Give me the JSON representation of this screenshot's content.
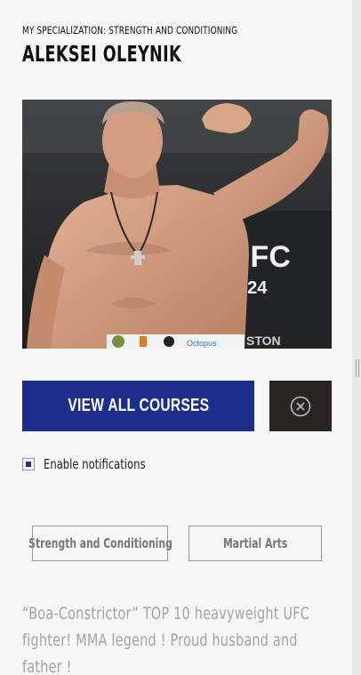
{
  "profile": {
    "specialization": "MY SPECIALIZATION: STRENGTH AND CONDITIONING",
    "name": "ALEKSEI OLEYNIK",
    "photo_alt": "",
    "banner_text": "UFC",
    "banner_number": "224",
    "banner_partial": "STON",
    "sponsor_text": "Octopus"
  },
  "actions": {
    "view_all_courses": "VIEW ALL COURSES",
    "close_icon": "close-circle-icon"
  },
  "notifications": {
    "label": "Enable notifications",
    "checked": true
  },
  "tags": [
    "Strength and Conditioning",
    "Martial Arts"
  ],
  "bio": "“Boa-Constrictor” TOP 10 heavyweight UFC fighter! MMA legend ! Proud husband and father !",
  "colors": {
    "primary": "#1c2d8c",
    "dark": "#2a2324",
    "muted_text": "#a3a3a3",
    "background": "#f6f6f6"
  }
}
